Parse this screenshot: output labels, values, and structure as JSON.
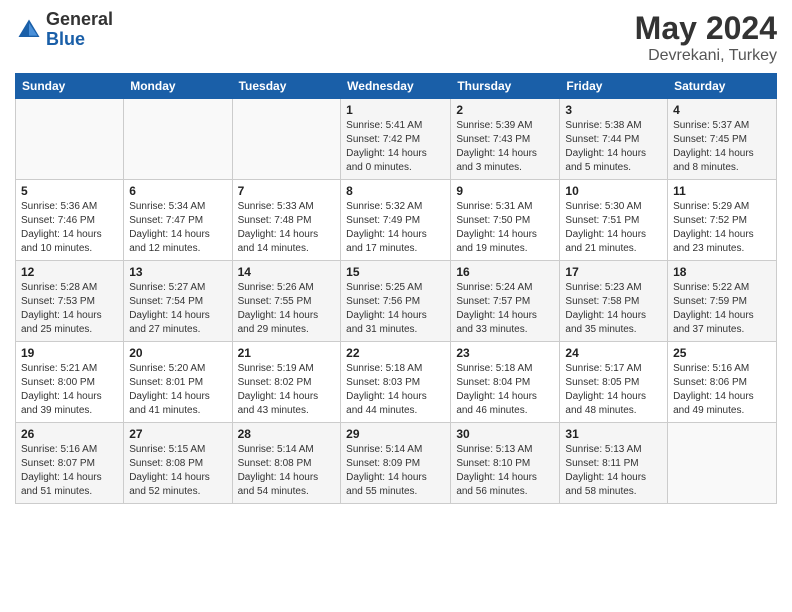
{
  "logo": {
    "general": "General",
    "blue": "Blue"
  },
  "header": {
    "title": "May 2024",
    "subtitle": "Devrekani, Turkey"
  },
  "weekdays": [
    "Sunday",
    "Monday",
    "Tuesday",
    "Wednesday",
    "Thursday",
    "Friday",
    "Saturday"
  ],
  "weeks": [
    [
      {
        "day": "",
        "info": ""
      },
      {
        "day": "",
        "info": ""
      },
      {
        "day": "",
        "info": ""
      },
      {
        "day": "1",
        "info": "Sunrise: 5:41 AM\nSunset: 7:42 PM\nDaylight: 14 hours\nand 0 minutes."
      },
      {
        "day": "2",
        "info": "Sunrise: 5:39 AM\nSunset: 7:43 PM\nDaylight: 14 hours\nand 3 minutes."
      },
      {
        "day": "3",
        "info": "Sunrise: 5:38 AM\nSunset: 7:44 PM\nDaylight: 14 hours\nand 5 minutes."
      },
      {
        "day": "4",
        "info": "Sunrise: 5:37 AM\nSunset: 7:45 PM\nDaylight: 14 hours\nand 8 minutes."
      }
    ],
    [
      {
        "day": "5",
        "info": "Sunrise: 5:36 AM\nSunset: 7:46 PM\nDaylight: 14 hours\nand 10 minutes."
      },
      {
        "day": "6",
        "info": "Sunrise: 5:34 AM\nSunset: 7:47 PM\nDaylight: 14 hours\nand 12 minutes."
      },
      {
        "day": "7",
        "info": "Sunrise: 5:33 AM\nSunset: 7:48 PM\nDaylight: 14 hours\nand 14 minutes."
      },
      {
        "day": "8",
        "info": "Sunrise: 5:32 AM\nSunset: 7:49 PM\nDaylight: 14 hours\nand 17 minutes."
      },
      {
        "day": "9",
        "info": "Sunrise: 5:31 AM\nSunset: 7:50 PM\nDaylight: 14 hours\nand 19 minutes."
      },
      {
        "day": "10",
        "info": "Sunrise: 5:30 AM\nSunset: 7:51 PM\nDaylight: 14 hours\nand 21 minutes."
      },
      {
        "day": "11",
        "info": "Sunrise: 5:29 AM\nSunset: 7:52 PM\nDaylight: 14 hours\nand 23 minutes."
      }
    ],
    [
      {
        "day": "12",
        "info": "Sunrise: 5:28 AM\nSunset: 7:53 PM\nDaylight: 14 hours\nand 25 minutes."
      },
      {
        "day": "13",
        "info": "Sunrise: 5:27 AM\nSunset: 7:54 PM\nDaylight: 14 hours\nand 27 minutes."
      },
      {
        "day": "14",
        "info": "Sunrise: 5:26 AM\nSunset: 7:55 PM\nDaylight: 14 hours\nand 29 minutes."
      },
      {
        "day": "15",
        "info": "Sunrise: 5:25 AM\nSunset: 7:56 PM\nDaylight: 14 hours\nand 31 minutes."
      },
      {
        "day": "16",
        "info": "Sunrise: 5:24 AM\nSunset: 7:57 PM\nDaylight: 14 hours\nand 33 minutes."
      },
      {
        "day": "17",
        "info": "Sunrise: 5:23 AM\nSunset: 7:58 PM\nDaylight: 14 hours\nand 35 minutes."
      },
      {
        "day": "18",
        "info": "Sunrise: 5:22 AM\nSunset: 7:59 PM\nDaylight: 14 hours\nand 37 minutes."
      }
    ],
    [
      {
        "day": "19",
        "info": "Sunrise: 5:21 AM\nSunset: 8:00 PM\nDaylight: 14 hours\nand 39 minutes."
      },
      {
        "day": "20",
        "info": "Sunrise: 5:20 AM\nSunset: 8:01 PM\nDaylight: 14 hours\nand 41 minutes."
      },
      {
        "day": "21",
        "info": "Sunrise: 5:19 AM\nSunset: 8:02 PM\nDaylight: 14 hours\nand 43 minutes."
      },
      {
        "day": "22",
        "info": "Sunrise: 5:18 AM\nSunset: 8:03 PM\nDaylight: 14 hours\nand 44 minutes."
      },
      {
        "day": "23",
        "info": "Sunrise: 5:18 AM\nSunset: 8:04 PM\nDaylight: 14 hours\nand 46 minutes."
      },
      {
        "day": "24",
        "info": "Sunrise: 5:17 AM\nSunset: 8:05 PM\nDaylight: 14 hours\nand 48 minutes."
      },
      {
        "day": "25",
        "info": "Sunrise: 5:16 AM\nSunset: 8:06 PM\nDaylight: 14 hours\nand 49 minutes."
      }
    ],
    [
      {
        "day": "26",
        "info": "Sunrise: 5:16 AM\nSunset: 8:07 PM\nDaylight: 14 hours\nand 51 minutes."
      },
      {
        "day": "27",
        "info": "Sunrise: 5:15 AM\nSunset: 8:08 PM\nDaylight: 14 hours\nand 52 minutes."
      },
      {
        "day": "28",
        "info": "Sunrise: 5:14 AM\nSunset: 8:08 PM\nDaylight: 14 hours\nand 54 minutes."
      },
      {
        "day": "29",
        "info": "Sunrise: 5:14 AM\nSunset: 8:09 PM\nDaylight: 14 hours\nand 55 minutes."
      },
      {
        "day": "30",
        "info": "Sunrise: 5:13 AM\nSunset: 8:10 PM\nDaylight: 14 hours\nand 56 minutes."
      },
      {
        "day": "31",
        "info": "Sunrise: 5:13 AM\nSunset: 8:11 PM\nDaylight: 14 hours\nand 58 minutes."
      },
      {
        "day": "",
        "info": ""
      }
    ]
  ]
}
